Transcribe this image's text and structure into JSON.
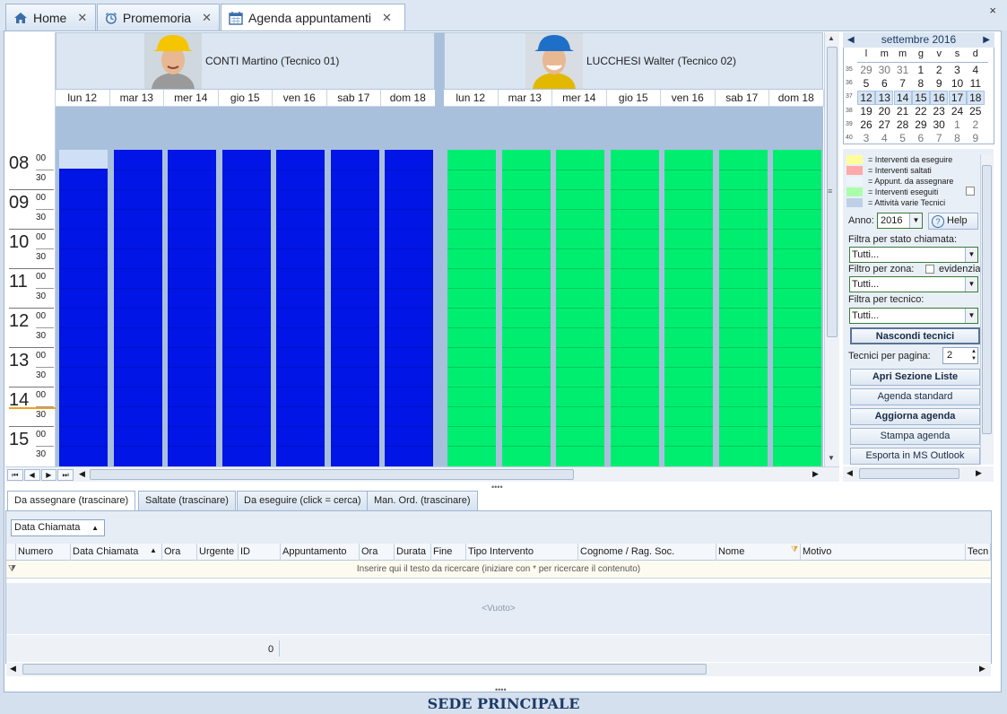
{
  "tabs": [
    {
      "label": "Home",
      "icon": "home-icon"
    },
    {
      "label": "Promemoria",
      "icon": "alarm-clock-icon"
    },
    {
      "label": "Agenda appuntamenti",
      "icon": "calendar-icon"
    }
  ],
  "close_all": "×",
  "resources": [
    {
      "name": "CONTI Martino (Tecnico 01)"
    },
    {
      "name": "LUCCHESI Walter (Tecnico 02)"
    }
  ],
  "days": [
    "lun 12",
    "mar 13",
    "mer 14",
    "gio 15",
    "ven 16",
    "sab 17",
    "dom 18"
  ],
  "hours": [
    "08",
    "09",
    "10",
    "11",
    "12",
    "13",
    "14",
    "15"
  ],
  "minutes": [
    "00",
    "30"
  ],
  "calendar": {
    "month": "settembre 2016",
    "weekdays": [
      "l",
      "m",
      "m",
      "g",
      "v",
      "s",
      "d"
    ],
    "weeks": [
      {
        "wk": "35",
        "days": [
          "29",
          "30",
          "31",
          "1",
          "2",
          "3",
          "4"
        ]
      },
      {
        "wk": "36",
        "days": [
          "5",
          "6",
          "7",
          "8",
          "9",
          "10",
          "11"
        ]
      },
      {
        "wk": "37",
        "days": [
          "12",
          "13",
          "14",
          "15",
          "16",
          "17",
          "18"
        ]
      },
      {
        "wk": "38",
        "days": [
          "19",
          "20",
          "21",
          "22",
          "23",
          "24",
          "25"
        ]
      },
      {
        "wk": "39",
        "days": [
          "26",
          "27",
          "28",
          "29",
          "30",
          "1",
          "2"
        ]
      },
      {
        "wk": "40",
        "days": [
          "3",
          "4",
          "5",
          "6",
          "7",
          "8",
          "9"
        ]
      }
    ]
  },
  "legend": [
    {
      "label": "= Interventi da eseguire",
      "color": "#ffff9a"
    },
    {
      "label": "= Interventi saltati",
      "color": "#ffaaaa"
    },
    {
      "label": "= Appunt. da assegnare",
      "color": "#eaf6fb"
    },
    {
      "label": "= Interventi eseguiti",
      "color": "#aaffaa"
    },
    {
      "label": "= Attività varie Tecnici",
      "color": "#bdd0e6"
    }
  ],
  "panel": {
    "anno_label": "Anno:",
    "anno_value": "2016",
    "help": "Help",
    "filter_stato_label": "Filtra per stato chiamata:",
    "filter_stato_value": "Tutti...",
    "filter_zona_label": "Filtro per zona:",
    "evidenzia": "evidenzia",
    "filter_zona_value": "Tutti...",
    "filter_tecnico_label": "Filtra per tecnico:",
    "filter_tecnico_value": "Tutti...",
    "nascondi": "Nascondi tecnici",
    "tecnici_label": "Tecnici per pagina:",
    "tecnici_value": "2",
    "btn_liste": "Apri Sezione Liste",
    "btn_standard": "Agenda standard",
    "btn_aggiorna": "Aggiorna agenda",
    "btn_stampa": "Stampa agenda",
    "btn_esporta": "Esporta in MS Outlook"
  },
  "lower_tabs": [
    "Da assegnare (trascinare)",
    "Saltate (trascinare)",
    "Da eseguire (click = cerca)",
    "Man. Ord. (trascinare)"
  ],
  "group_chip": "Data Chiamata",
  "columns": [
    "Numero",
    "Data Chiamata",
    "Ora",
    "Urgente",
    "ID",
    "Appuntamento",
    "Ora",
    "Durata",
    "Fine",
    "Tipo Intervento",
    "Cognome / Rag. Soc.",
    "Nome",
    "Motivo",
    "Tecn"
  ],
  "filter_placeholder": "Inserire qui il testo da ricercare (iniziare con * per ricercare il contenuto)",
  "empty": "<Vuoto>",
  "footer_count": "0",
  "status": "SEDE PRINCIPALE",
  "colors": {
    "busy_blue": "#0015e6",
    "free_green": "#00ee70"
  }
}
